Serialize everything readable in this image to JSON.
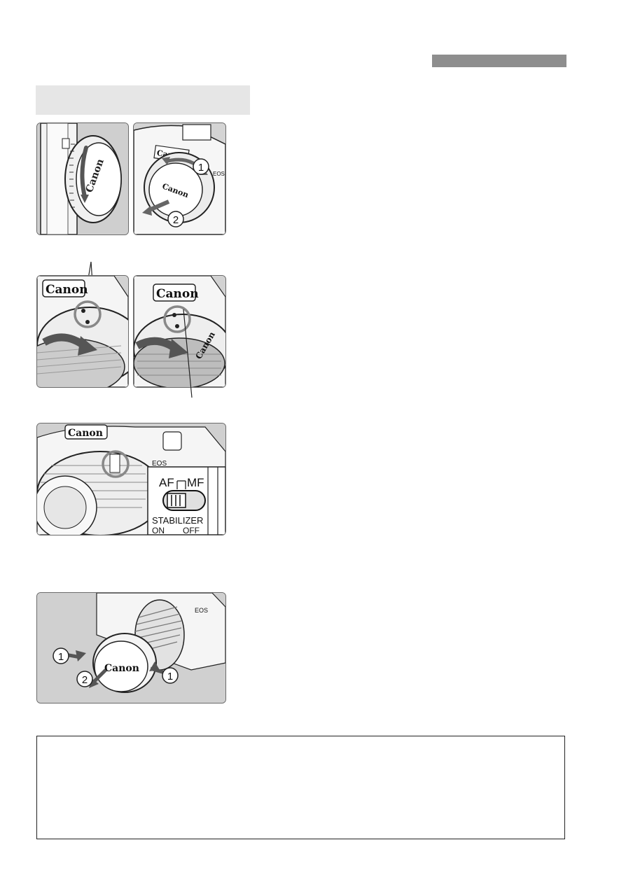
{
  "illustrations": {
    "lens_cap_panel": {
      "brand_text": "Canon"
    },
    "body_cap_panel": {
      "brand_text": "Canon",
      "body_text": "EOS",
      "step_1": "1",
      "step_2": "2"
    },
    "mount_index_left": {
      "brand_text": "Canon"
    },
    "mount_index_right": {
      "brand_text": "Canon"
    },
    "switch_panel": {
      "brand_text": "Canon",
      "body_text": "EOS",
      "af_label": "AF",
      "mf_label": "MF",
      "stabilizer_label": "STABILIZER",
      "on_label": "ON",
      "off_label": "OFF"
    },
    "front_cap_panel": {
      "brand_text": "Canon",
      "body_text": "EOS",
      "step_1": "1",
      "step_2": "2"
    }
  },
  "colors": {
    "header_bar": "#8e8e8e",
    "section_box": "#e6e6e6",
    "panel_bg": "#d0d0d0"
  }
}
